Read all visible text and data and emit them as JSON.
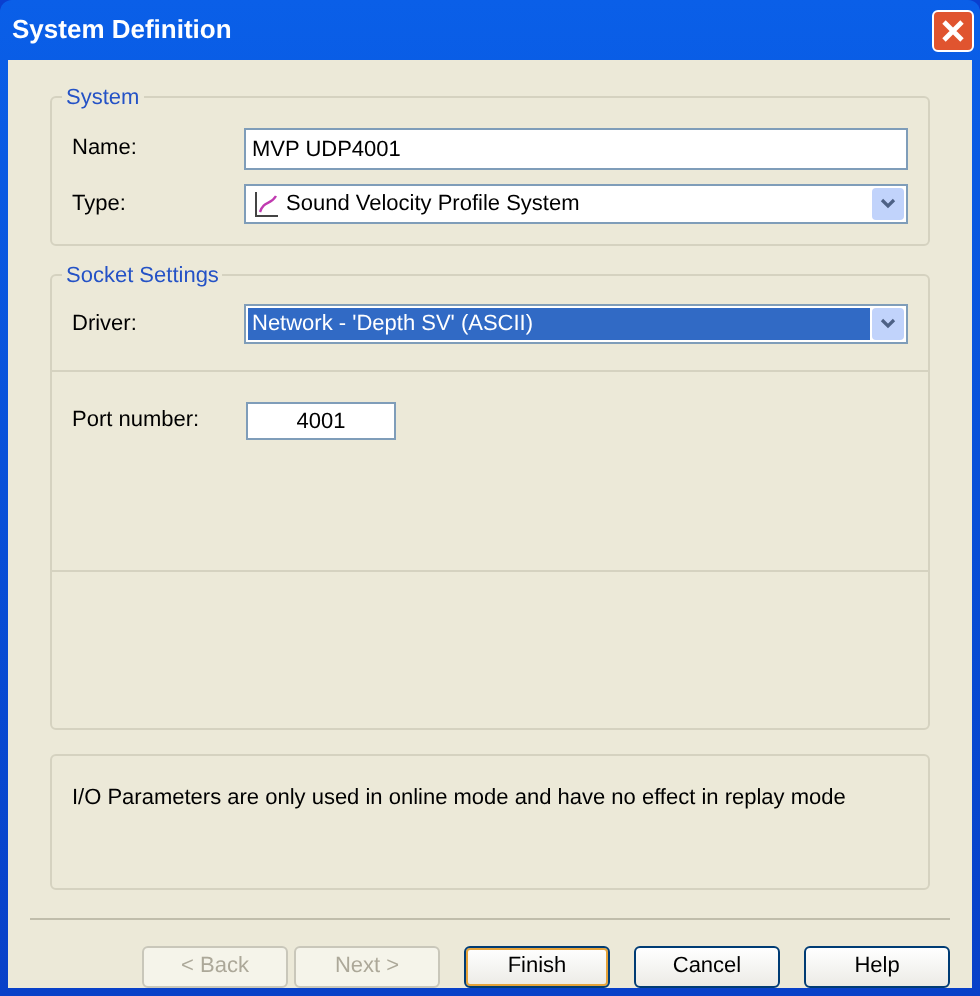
{
  "window": {
    "title": "System Definition"
  },
  "system": {
    "title": "System",
    "name_label": "Name:",
    "name_value": "MVP UDP4001",
    "type_label": "Type:",
    "type_value": "Sound Velocity Profile System"
  },
  "socket": {
    "title": "Socket Settings",
    "driver_label": "Driver:",
    "driver_value": "Network - 'Depth SV' (ASCII)",
    "driver_selected": true,
    "port_label": "Port number:",
    "port_value": "4001"
  },
  "info": {
    "text": "I/O Parameters are only used in online mode and have no effect in replay mode"
  },
  "buttons": [
    {
      "label": "< Back",
      "disabled": true,
      "default": false
    },
    {
      "label": "Next >",
      "disabled": true,
      "default": false
    },
    {
      "label": "Finish",
      "disabled": false,
      "default": true
    },
    {
      "label": "Cancel",
      "disabled": false,
      "default": false
    },
    {
      "label": "Help",
      "disabled": false,
      "default": false
    }
  ]
}
